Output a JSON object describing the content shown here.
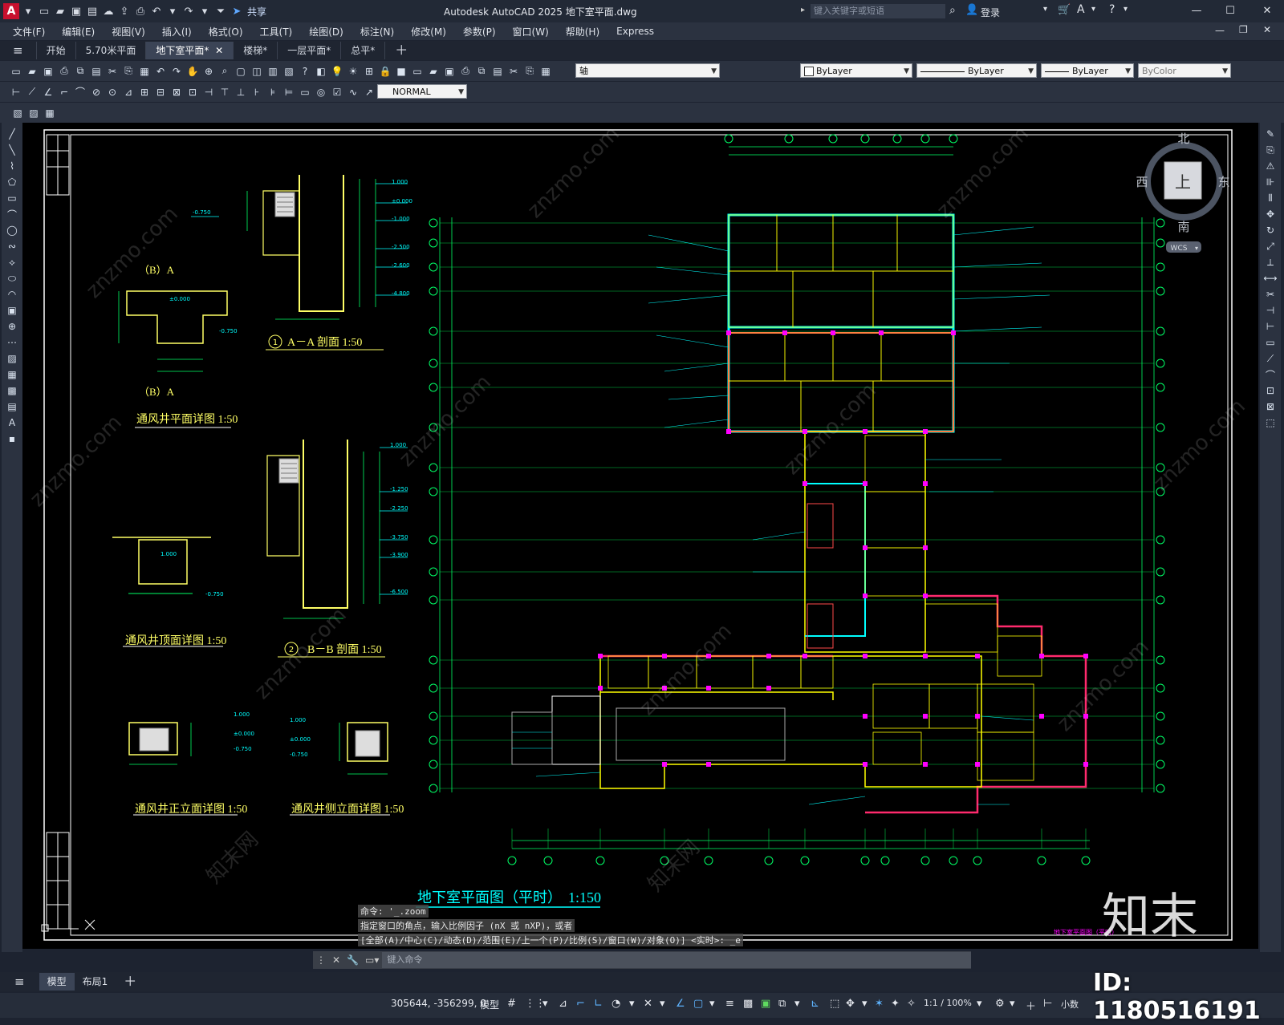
{
  "app": {
    "title": "Autodesk AutoCAD 2025    地下室平面.dwg",
    "search_placeholder": "键入关键字或短语",
    "login": "登录",
    "share": "共享",
    "logo_letter": "A"
  },
  "menu": [
    "文件(F)",
    "编辑(E)",
    "视图(V)",
    "插入(I)",
    "格式(O)",
    "工具(T)",
    "绘图(D)",
    "标注(N)",
    "修改(M)",
    "参数(P)",
    "窗口(W)",
    "帮助(H)",
    "Express"
  ],
  "file_tabs": [
    {
      "label": "开始",
      "active": false
    },
    {
      "label": "5.70米平面",
      "active": false
    },
    {
      "label": "地下室平面*",
      "active": true
    },
    {
      "label": "楼梯*",
      "active": false
    },
    {
      "label": "一层平面*",
      "active": false
    },
    {
      "label": "总平*",
      "active": false
    }
  ],
  "toolbar": {
    "layer_value": "轴",
    "color_value": "ByLayer",
    "linetype_value": "ByLayer",
    "lineweight_value": "ByLayer",
    "plotstyle_value": "ByColor",
    "dimstyle_value": "NORMAL"
  },
  "viewcube": {
    "north": "北",
    "south": "南",
    "east": "东",
    "west": "西",
    "top": "上",
    "wcs": "WCS"
  },
  "drawing": {
    "main_title": "地下室平面图（平时）",
    "main_scale": "1:150",
    "detail_aa": "A－A 剖面 1:50",
    "detail_bb": "B－B 剖面 1:50",
    "detail_1": "通风井平面详图 1:50",
    "detail_2": "通风井顶面详图 1:50",
    "detail_3": "通风井正立面详图 1:50",
    "detail_4": "通风井侧立面详图 1:50",
    "ba_label_1": "（B）A",
    "ba_label_2": "（B）A",
    "num_1": "1",
    "num_2": "2",
    "elev_labels": [
      "1.000",
      "±0.000",
      "-1.000",
      "-2.500",
      "-2.600",
      "-4.800",
      "-0.750",
      "-1.250",
      "-2.250",
      "-3.750",
      "-3.900",
      "-6.500"
    ],
    "corner_label": "地下室平面图（平时）",
    "watermark_cn": "知末",
    "watermark_site": "znzmo.com",
    "watermark_text": "知末网"
  },
  "command": {
    "history": [
      "命令: '_.zoom",
      "指定窗口的角点，输入比例因子 (nX 或 nXP)，或者",
      "[全部(A)/中心(C)/动态(D)/范围(E)/上一个(P)/比例(S)/窗口(W)/对象(O)] <实时>: _e"
    ],
    "placeholder": "键入命令"
  },
  "layout_tabs": [
    {
      "label": "模型",
      "active": true
    },
    {
      "label": "布局1",
      "active": false
    }
  ],
  "status": {
    "coords": "305644, -356299, 0",
    "model": "模型",
    "scale": "1:1 / 100%",
    "units": "小数"
  },
  "overlay_id": "ID: 1180516191"
}
